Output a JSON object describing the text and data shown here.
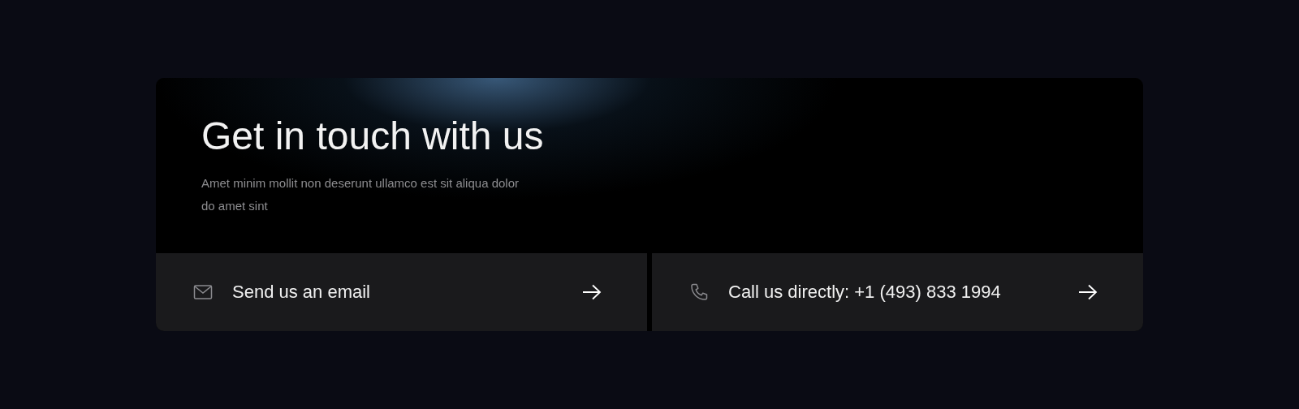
{
  "heading": {
    "title": "Get in touch with us",
    "subtitle": "Amet minim mollit non deserunt ullamco est sit aliqua dolor do amet sint"
  },
  "actions": [
    {
      "kind": "email",
      "label": "Send us an email"
    },
    {
      "kind": "phone",
      "label": "Call us directly: +1 (493) 833 1994"
    }
  ]
}
